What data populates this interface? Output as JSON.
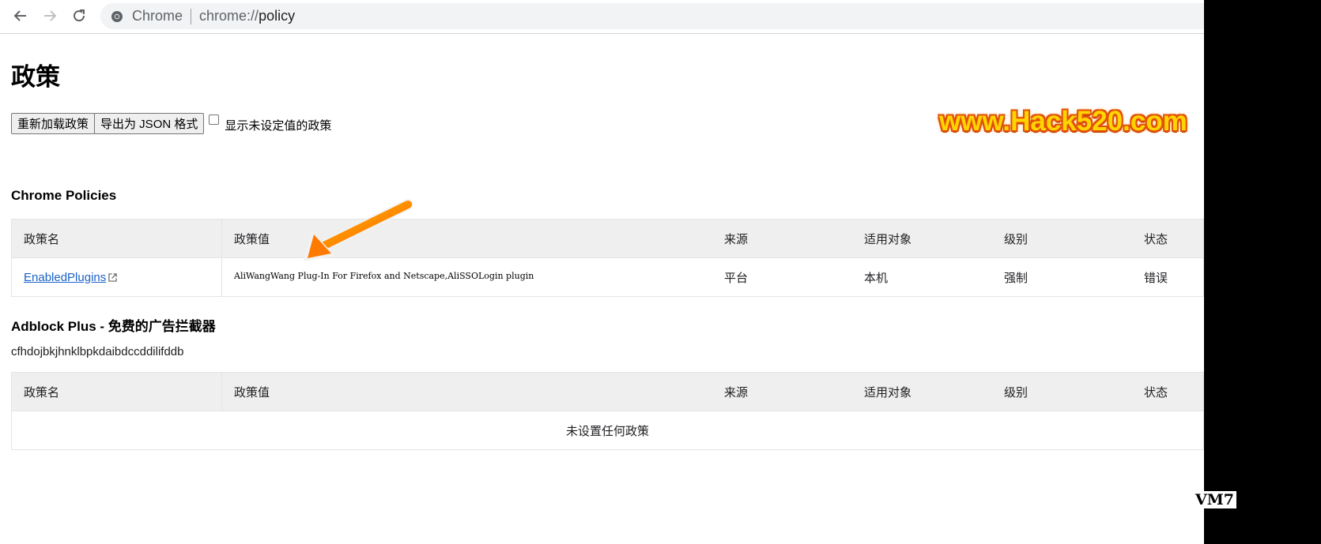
{
  "browser": {
    "back_icon": "back-arrow-icon",
    "forward_icon": "forward-arrow-icon",
    "reload_icon": "reload-icon",
    "site_icon": "chrome-icon",
    "site_label": "Chrome",
    "url_scheme": "chrome://",
    "url_path": "policy"
  },
  "page": {
    "title": "政策",
    "reload_button": "重新加载政策",
    "export_button": "导出为 JSON 格式",
    "show_unset_label": "显示未设定值的政策",
    "show_unset_checked": false
  },
  "watermark": "www.Hack520.com",
  "headers": {
    "name": "政策名",
    "value": "政策值",
    "source": "来源",
    "scope": "适用对象",
    "level": "级别",
    "status": "状态"
  },
  "chrome_policies": {
    "title": "Chrome Policies",
    "rows": [
      {
        "name": "EnabledPlugins",
        "value": "AliWangWang Plug-In For Firefox and Netscape,AliSSOLogin plugin",
        "source": "平台",
        "scope": "本机",
        "level": "强制",
        "status": "错误"
      }
    ]
  },
  "adblock": {
    "title": "Adblock Plus - 免费的广告拦截器",
    "id": "cfhdojbkjhnklbpkdaibdccddilifddb",
    "empty_text": "未设置任何政策"
  },
  "overlay": {
    "vm_label": "VM7",
    "arrow_color": "#ff7a00"
  }
}
